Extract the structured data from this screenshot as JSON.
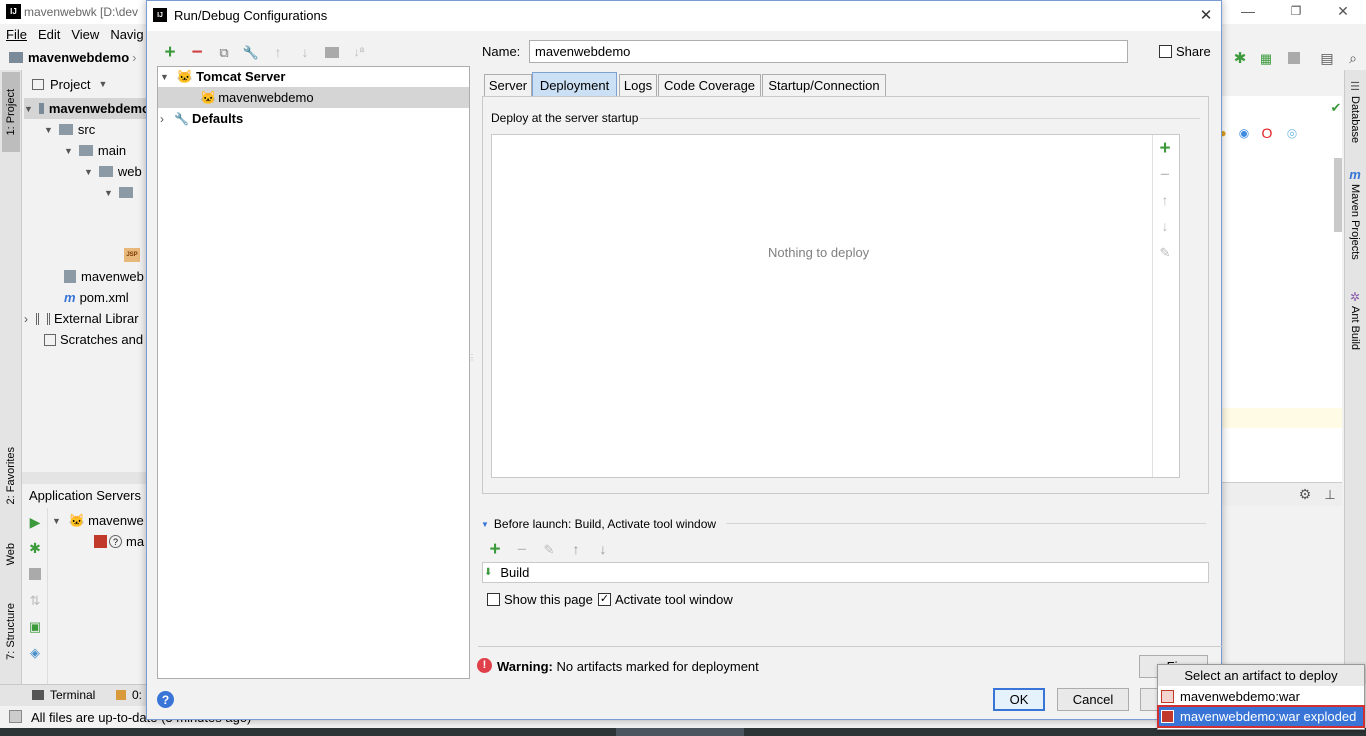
{
  "ide": {
    "title": "mavenwebwk [D:\\dev",
    "menu": [
      "File",
      "Edit",
      "View",
      "Navig"
    ],
    "breadcrumb": "mavenwebdemo",
    "project_header": "Project",
    "left_strip": {
      "project": "1: Project",
      "favorites": "2: Favorites",
      "web": "Web",
      "structure": "7: Structure"
    },
    "right_strip": {
      "database": "Database",
      "maven": "Maven Projects",
      "ant": "Ant Build"
    },
    "project_tree": [
      {
        "label": "mavenwebdemo",
        "bold": true
      },
      {
        "label": "src"
      },
      {
        "label": "main"
      },
      {
        "label": "web"
      },
      {
        "label": "mavenweb"
      },
      {
        "label": "pom.xml"
      },
      {
        "label": "External Librar"
      },
      {
        "label": "Scratches and"
      }
    ],
    "app_servers": {
      "header": "Application Servers",
      "server": "mavenwe",
      "artifact": "ma"
    },
    "bottom_tabs": {
      "terminal": "Terminal",
      "other": "0:"
    },
    "status": "All files are up-to-date (3 minutes ago)"
  },
  "dialog": {
    "title": "Run/Debug Configurations",
    "close": "✕",
    "tree": {
      "tomcat": "Tomcat Server",
      "config": "mavenwebdemo",
      "defaults": "Defaults"
    },
    "name_label": "Name:",
    "name_value": "mavenwebdemo",
    "share_label": "Share",
    "tabs": [
      "Server",
      "Deployment",
      "Logs",
      "Code Coverage",
      "Startup/Connection"
    ],
    "active_tab": "Deployment",
    "deploy_header": "Deploy at the server startup",
    "deploy_empty": "Nothing to deploy",
    "before_launch": "Before launch: Build, Activate tool window",
    "build_item": "Build",
    "show_page": "Show this page",
    "activate_tool": "Activate tool window",
    "warning_bold": "Warning:",
    "warning_text": "No artifacts marked for deployment",
    "fix": "Fix",
    "ok": "OK",
    "cancel": "Cancel",
    "help": "?"
  },
  "popup": {
    "title": "Select an artifact to deploy",
    "items": [
      "mavenwebdemo:war",
      "mavenwebdemo:war exploded"
    ],
    "selected_index": 1
  },
  "colors": {
    "accent": "#3875d7",
    "green": "#3c9a3c",
    "warning": "#e0404a",
    "selection": "#d5d5d5"
  }
}
